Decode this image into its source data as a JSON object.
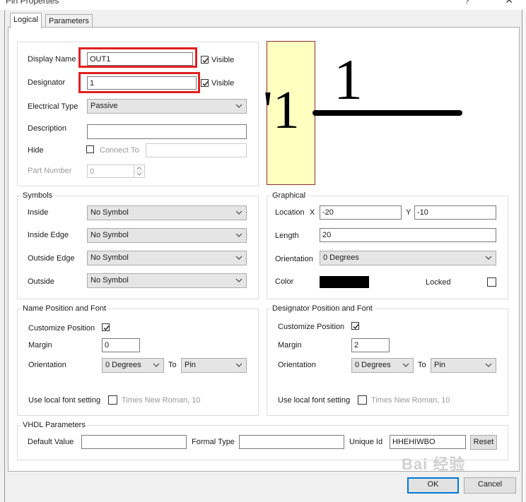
{
  "window": {
    "title": "Pin Properties",
    "help": "?",
    "close": "✕"
  },
  "tabs": [
    {
      "label": "Logical"
    },
    {
      "label": "Parameters"
    }
  ],
  "logical": {
    "display_name": {
      "label": "Display Name",
      "value": "OUT1",
      "visible_label": "Visible",
      "visible": true
    },
    "designator": {
      "label": "Designator",
      "value": "1",
      "visible_label": "Visible",
      "visible": true
    },
    "electrical_type": {
      "label": "Electrical Type",
      "value": "Passive"
    },
    "description": {
      "label": "Description",
      "value": ""
    },
    "hide": {
      "label": "Hide",
      "checked": false,
      "connect_to_label": "Connect To",
      "connect_to_value": ""
    },
    "part_number": {
      "label": "Part Number",
      "value": "0"
    }
  },
  "preview": {
    "pin_name": "'1",
    "designator": "1"
  },
  "symbols": {
    "title": "Symbols",
    "inside": {
      "label": "Inside",
      "value": "No Symbol"
    },
    "inside_edge": {
      "label": "Inside Edge",
      "value": "No Symbol"
    },
    "outside_edge": {
      "label": "Outside Edge",
      "value": "No Symbol"
    },
    "outside": {
      "label": "Outside",
      "value": "No Symbol"
    }
  },
  "graphical": {
    "title": "Graphical",
    "location_label": "Location",
    "x_label": "X",
    "x_value": "-20",
    "y_label": "Y",
    "y_value": "-10",
    "length_label": "Length",
    "length_value": "20",
    "orientation_label": "Orientation",
    "orientation_value": "0 Degrees",
    "color_label": "Color",
    "color_value": "#000000",
    "locked_label": "Locked",
    "locked": false
  },
  "name_pos": {
    "title": "Name Position and Font",
    "customize_label": "Customize Position",
    "customize": true,
    "margin_label": "Margin",
    "margin_value": "0",
    "orientation_label": "Orientation",
    "orientation_value": "0 Degrees",
    "to_label": "To",
    "to_value": "Pin",
    "font_label": "Use local font setting",
    "font_checked": false,
    "font_value": "Times New Roman, 10"
  },
  "desig_pos": {
    "title": "Designator Position and Font",
    "customize_label": "Customize Position",
    "customize": true,
    "margin_label": "Margin",
    "margin_value": "2",
    "orientation_label": "Orientation",
    "orientation_value": "0 Degrees",
    "to_label": "To",
    "to_value": "Pin",
    "font_label": "Use local font setting",
    "font_checked": false,
    "font_value": "Times New Roman, 10"
  },
  "vhdl": {
    "title": "VHDL Parameters",
    "default_value_label": "Default Value",
    "default_value": "",
    "formal_type_label": "Formal Type",
    "formal_type": "",
    "unique_id_label": "Unique Id",
    "unique_id": "HHEHIWBO",
    "reset_label": "Reset"
  },
  "footer": {
    "ok_label": "OK",
    "cancel_label": "Cancel"
  },
  "watermark": "Bai 经验"
}
